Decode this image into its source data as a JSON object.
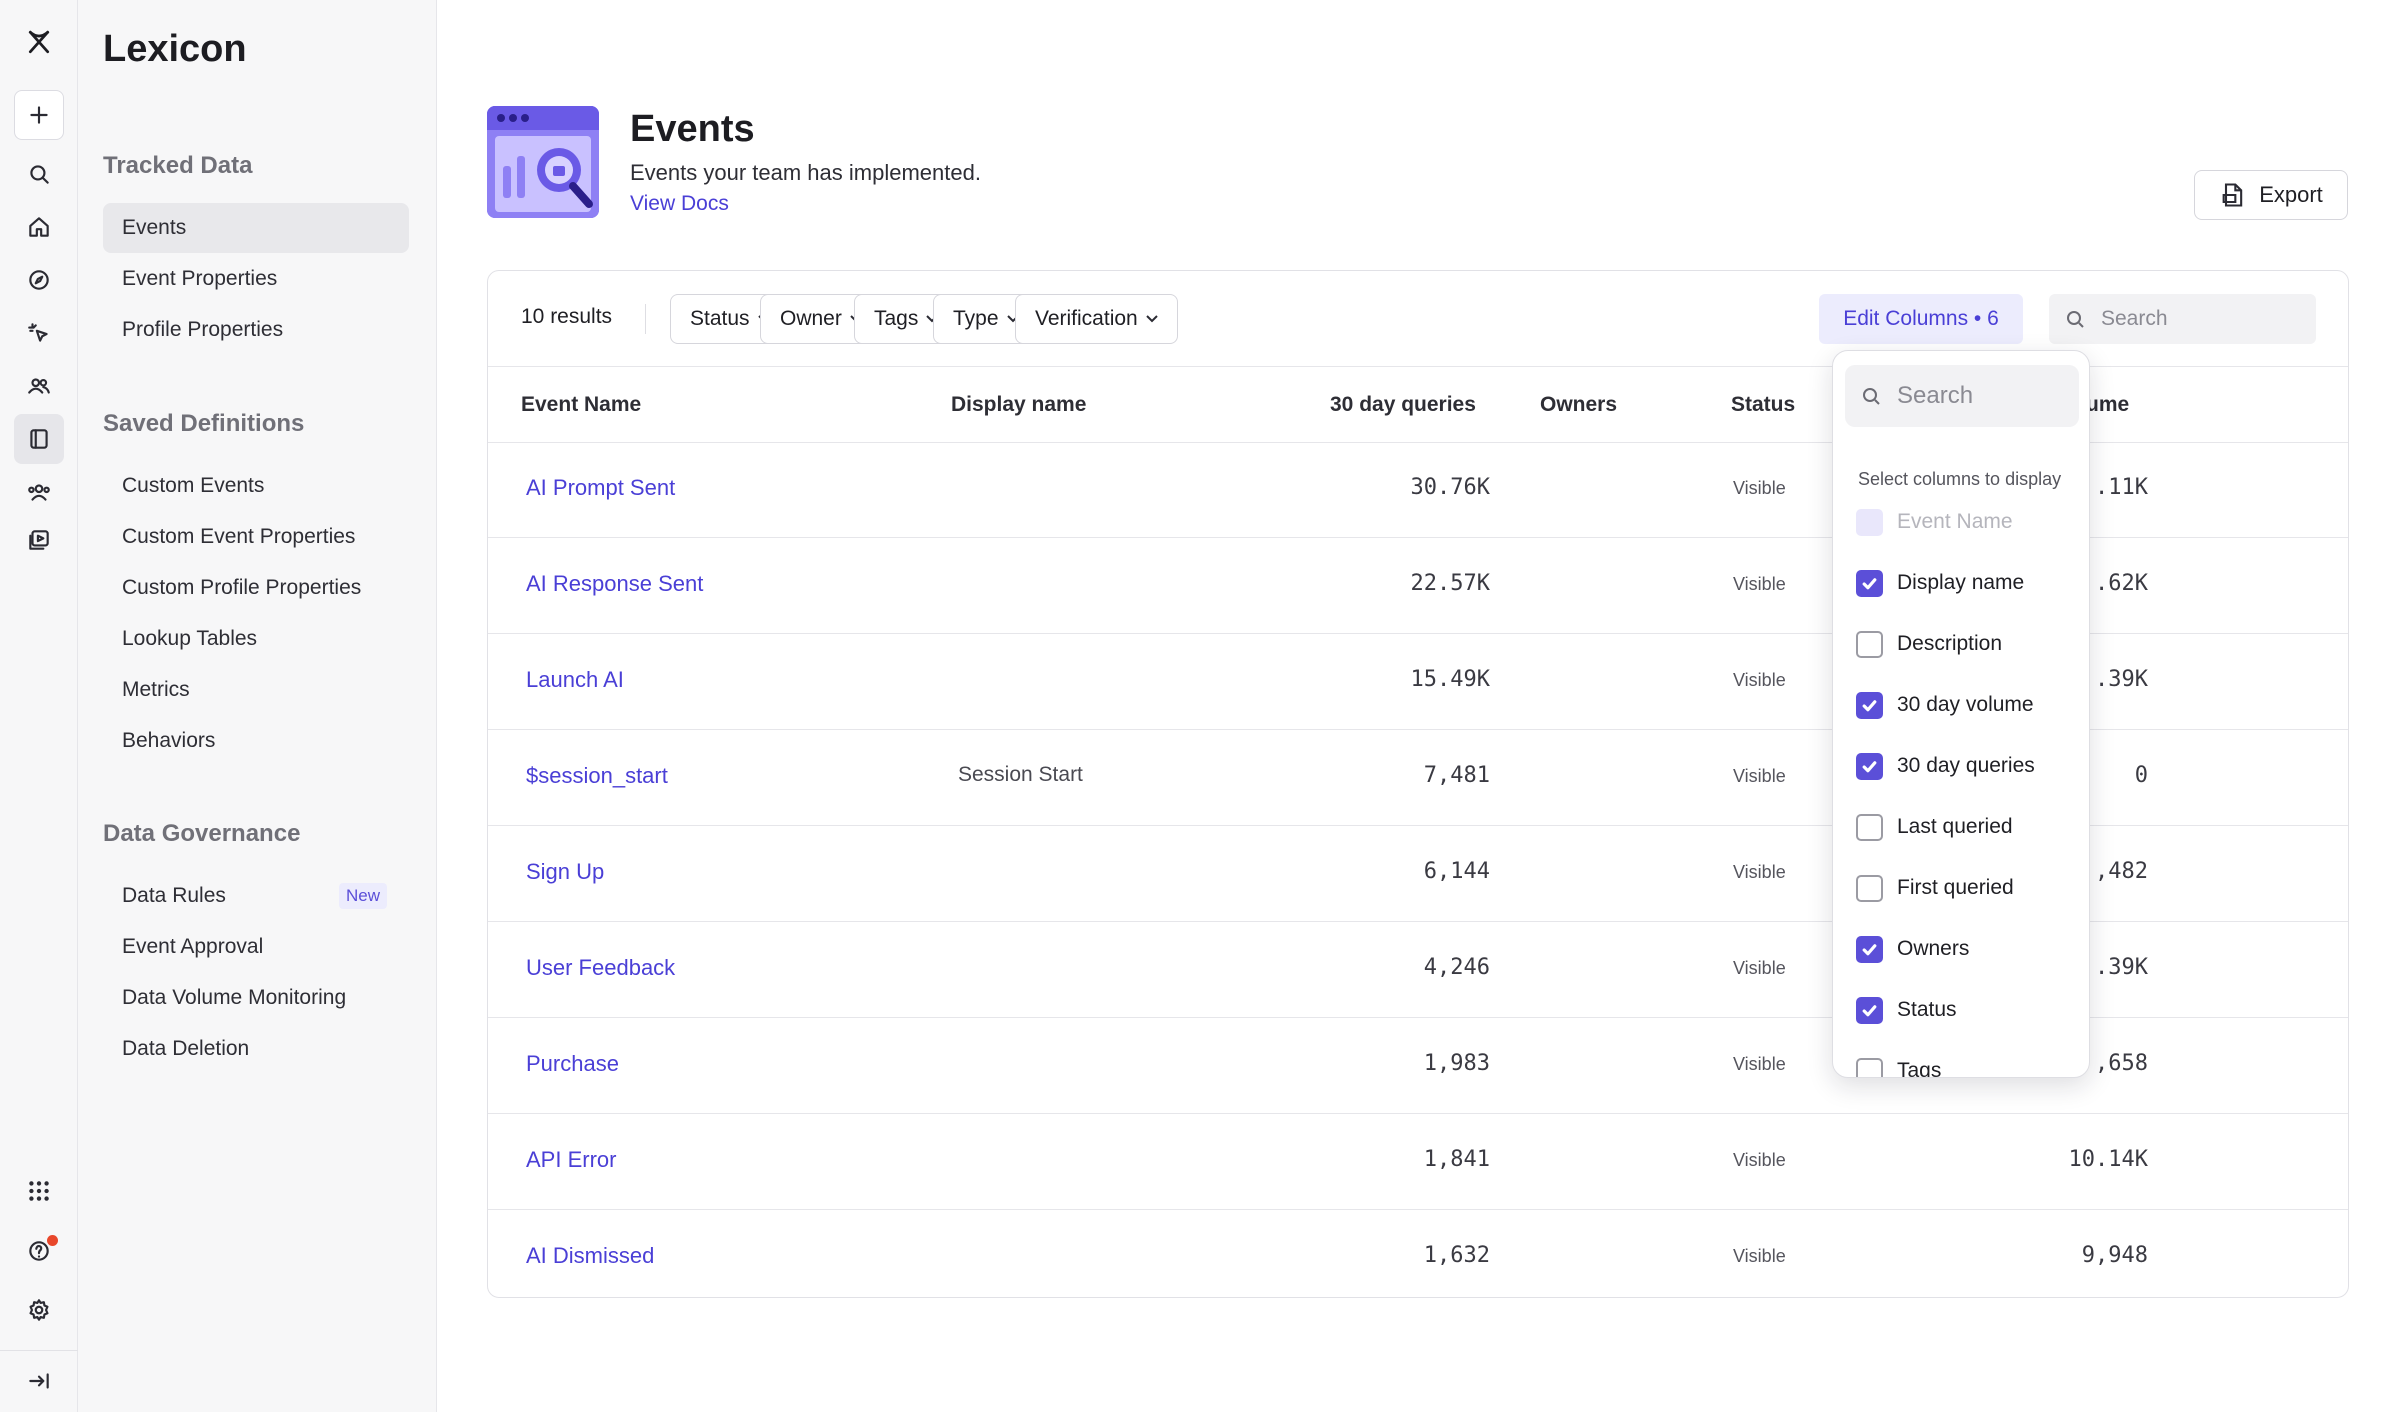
{
  "sidebar": {
    "app_title": "Lexicon",
    "sections": [
      {
        "title": "Tracked Data",
        "items": [
          {
            "label": "Events",
            "active": true
          },
          {
            "label": "Event Properties"
          },
          {
            "label": "Profile Properties"
          }
        ]
      },
      {
        "title": "Saved Definitions",
        "items": [
          {
            "label": "Custom Events"
          },
          {
            "label": "Custom Event Properties"
          },
          {
            "label": "Custom Profile Properties"
          },
          {
            "label": "Lookup Tables"
          },
          {
            "label": "Metrics"
          },
          {
            "label": "Behaviors"
          }
        ]
      },
      {
        "title": "Data Governance",
        "items": [
          {
            "label": "Data Rules",
            "badge": "New"
          },
          {
            "label": "Event Approval"
          },
          {
            "label": "Data Volume Monitoring"
          },
          {
            "label": "Data Deletion"
          }
        ]
      }
    ]
  },
  "rail_icons": [
    "logo-icon",
    "plus-icon",
    "search-icon",
    "home-icon",
    "compass-icon",
    "sparkle-cursor-icon",
    "users-icon",
    "lexicon-book-icon",
    "team-icon",
    "video-icon",
    "apps-grid-icon",
    "help-icon",
    "settings-icon",
    "collapse-icon"
  ],
  "header": {
    "title": "Events",
    "subtitle": "Events your team has implemented.",
    "docs_link": "View Docs",
    "export_label": "Export"
  },
  "toolbar": {
    "results": "10 results",
    "filters": [
      "Status",
      "Owner",
      "Tags",
      "Type",
      "Verification"
    ],
    "edit_columns": "Edit Columns • 6",
    "search_placeholder": "Search"
  },
  "table": {
    "columns": [
      "Event Name",
      "Display name",
      "30 day queries",
      "Owners",
      "Status",
      "ume"
    ],
    "rows": [
      {
        "name": "AI Prompt Sent",
        "display": "",
        "queries": "30.76K",
        "status": "Visible",
        "volume": ".11K"
      },
      {
        "name": "AI Response Sent",
        "display": "",
        "queries": "22.57K",
        "status": "Visible",
        "volume": ".62K"
      },
      {
        "name": "Launch AI",
        "display": "",
        "queries": "15.49K",
        "status": "Visible",
        "volume": ".39K"
      },
      {
        "name": "$session_start",
        "display": "Session Start",
        "queries": "7,481",
        "status": "Visible",
        "volume": "0"
      },
      {
        "name": "Sign Up",
        "display": "",
        "queries": "6,144",
        "status": "Visible",
        "volume": ",482"
      },
      {
        "name": "User Feedback",
        "display": "",
        "queries": "4,246",
        "status": "Visible",
        "volume": ".39K"
      },
      {
        "name": "Purchase",
        "display": "",
        "queries": "1,983",
        "status": "Visible",
        "volume": ",658"
      },
      {
        "name": "API Error",
        "display": "",
        "queries": "1,841",
        "status": "Visible",
        "volume": "10.14K"
      },
      {
        "name": "AI Dismissed",
        "display": "",
        "queries": "1,632",
        "status": "Visible",
        "volume": "9,948"
      }
    ]
  },
  "column_picker": {
    "search_placeholder": "Search",
    "hint": "Select columns to display",
    "options": [
      {
        "label": "Event Name",
        "checked": true,
        "disabled": true
      },
      {
        "label": "Display name",
        "checked": true
      },
      {
        "label": "Description",
        "checked": false
      },
      {
        "label": "30 day volume",
        "checked": true
      },
      {
        "label": "30 day queries",
        "checked": true
      },
      {
        "label": "Last queried",
        "checked": false
      },
      {
        "label": "First queried",
        "checked": false
      },
      {
        "label": "Owners",
        "checked": true
      },
      {
        "label": "Status",
        "checked": true
      },
      {
        "label": "Tags",
        "checked": false
      }
    ]
  },
  "colors": {
    "accent": "#5b4fd8",
    "link": "#4a3fd6",
    "accent_soft": "#ececfd",
    "notification": "#e8472b"
  }
}
